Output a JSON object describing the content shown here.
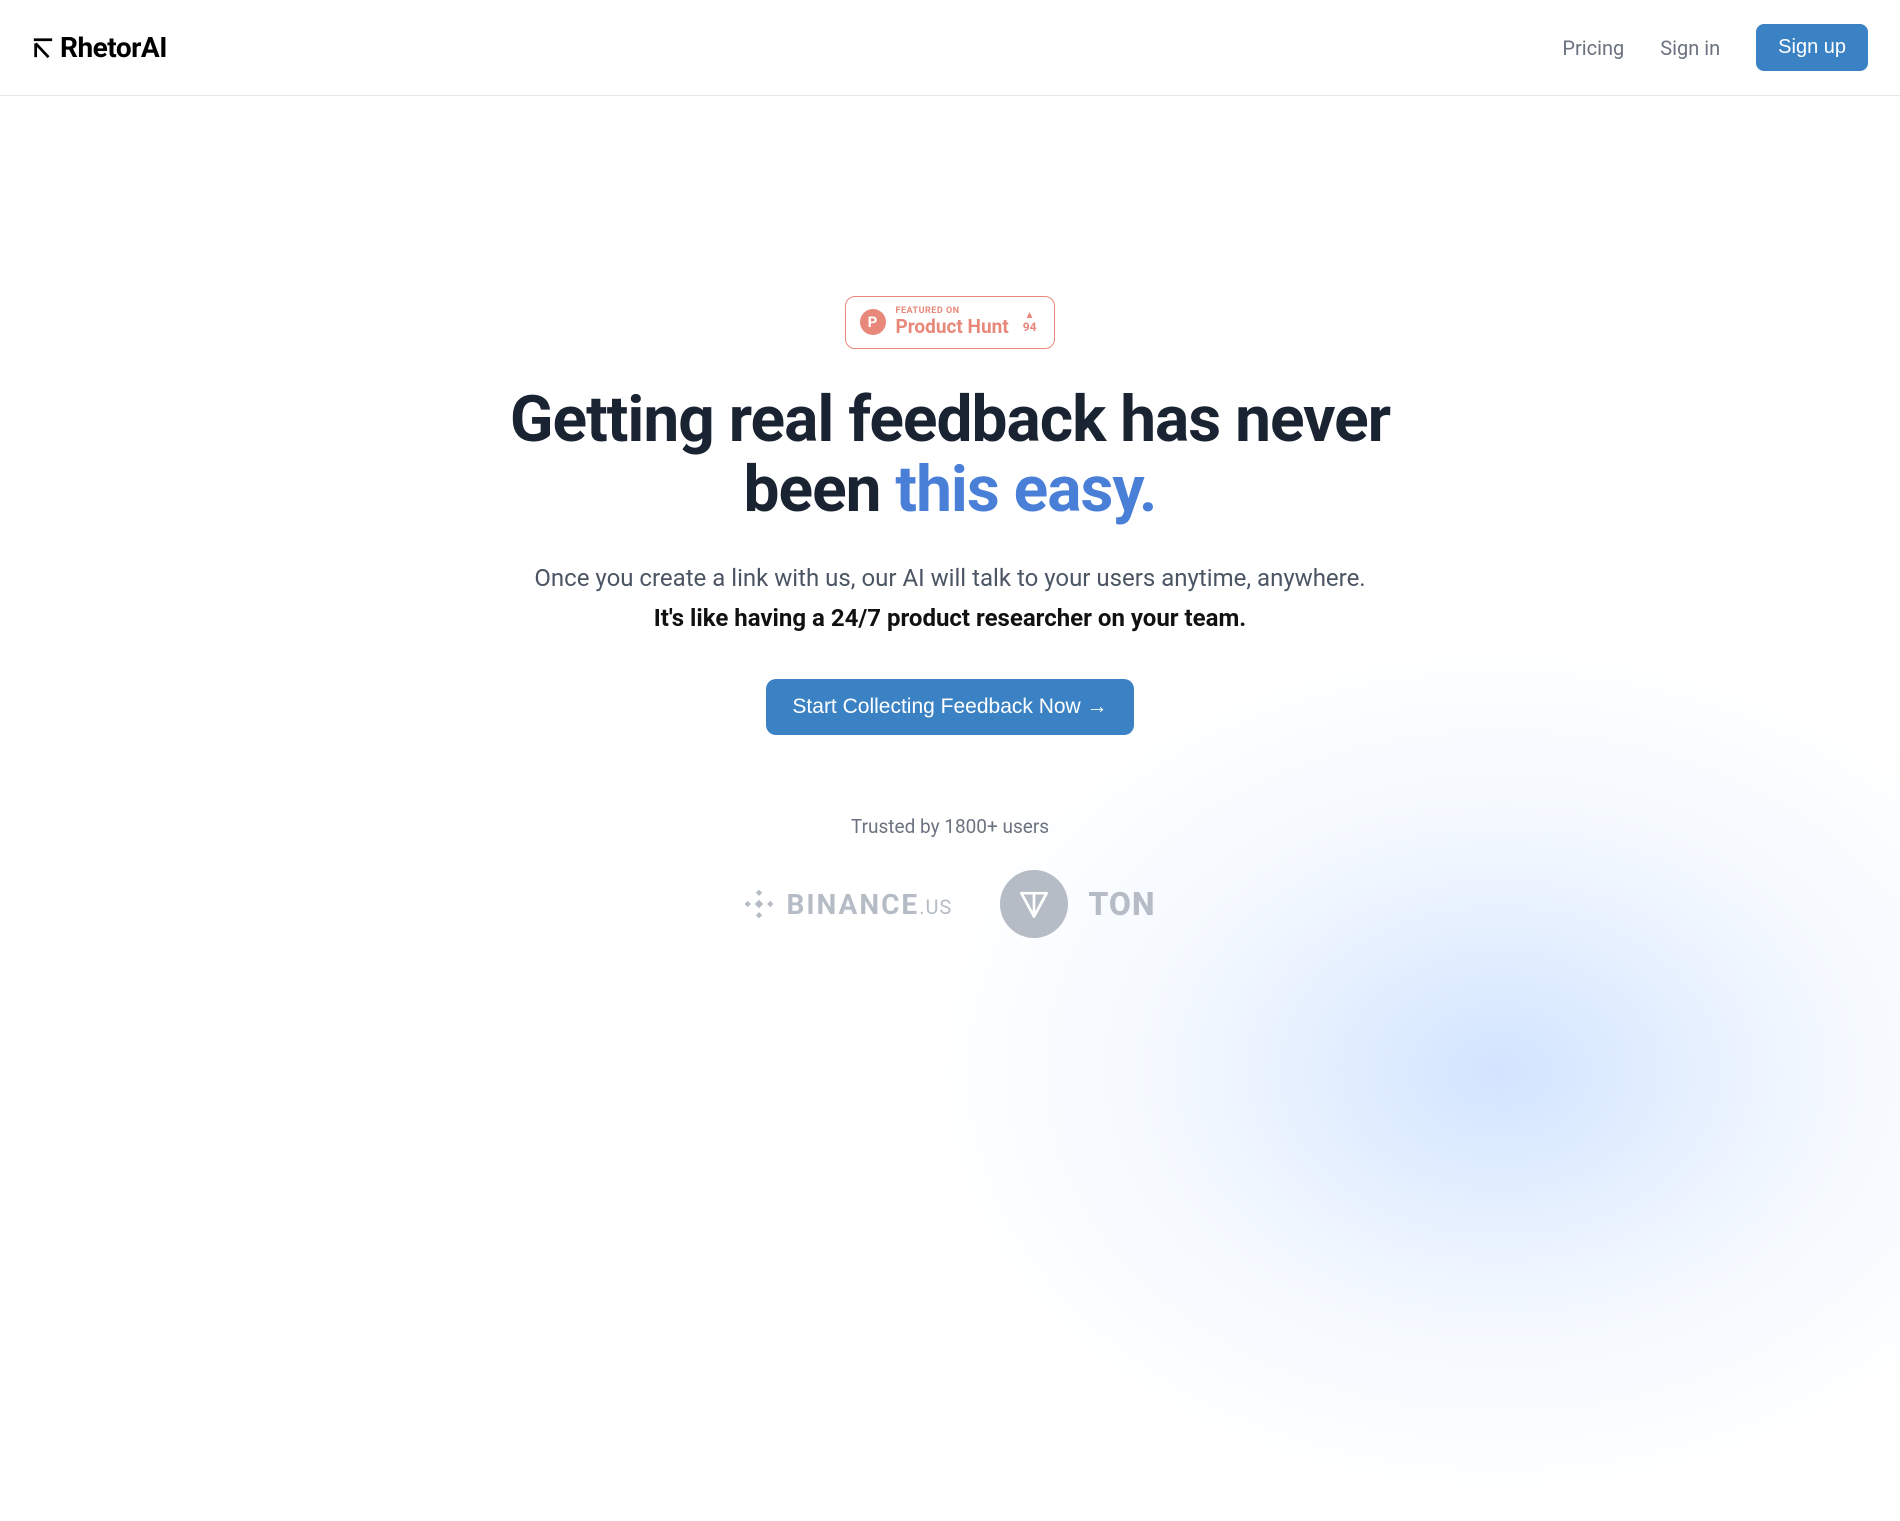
{
  "header": {
    "logo_text": "RhetorAI",
    "nav": {
      "pricing": "Pricing",
      "signin": "Sign in",
      "signup": "Sign up"
    }
  },
  "ph_badge": {
    "featured_on": "FEATURED ON",
    "name": "Product Hunt",
    "upvotes": "94",
    "letter": "P"
  },
  "hero": {
    "headline_part1": "Getting real feedback has never been ",
    "headline_accent": "this easy.",
    "subhead_line1": "Once you create a link with us, our AI will talk to your users anytime, anywhere.",
    "subhead_line2": "It's like having a 24/7 product researcher on your team.",
    "cta_label": "Start Collecting Feedback Now →"
  },
  "trust": {
    "label": "Trusted by 1800+ users",
    "logos": {
      "binance_main": "BINANCE",
      "binance_suffix": ".US",
      "ton": "TON"
    }
  }
}
